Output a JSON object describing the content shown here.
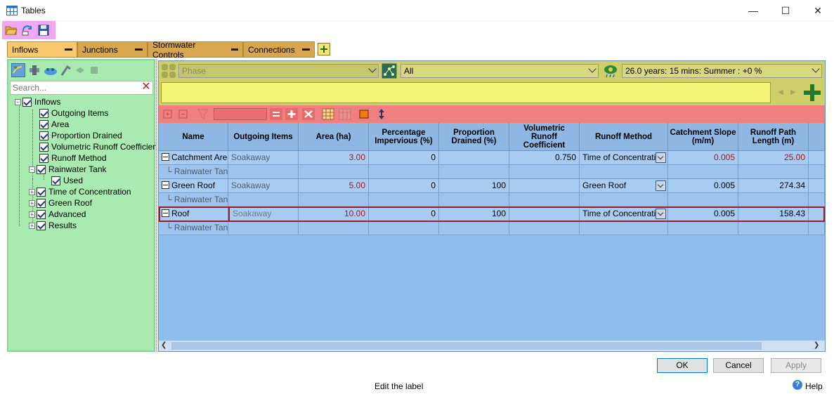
{
  "window": {
    "title": "Tables",
    "min": "—",
    "max": "☐",
    "close": "✕"
  },
  "toolbar": {
    "icons": [
      "open-folder-icon",
      "refresh-icon",
      "save-icon"
    ]
  },
  "tabs": [
    {
      "label": "Inflows",
      "active": true
    },
    {
      "label": "Junctions"
    },
    {
      "label": "Stormwater Controls"
    },
    {
      "label": "Connections"
    }
  ],
  "tree": {
    "search_placeholder": "Search...",
    "nodes": [
      {
        "label": "Inflows"
      },
      {
        "label": "Outgoing Items"
      },
      {
        "label": "Area"
      },
      {
        "label": "Proportion Drained"
      },
      {
        "label": "Volumetric Runoff Coefficient"
      },
      {
        "label": "Runoff Method"
      },
      {
        "label": "Rainwater Tank"
      },
      {
        "label": "Used"
      },
      {
        "label": "Time of Concentration"
      },
      {
        "label": "Green Roof"
      },
      {
        "label": "Advanced"
      },
      {
        "label": "Results"
      }
    ]
  },
  "filters": {
    "phase": "Phase",
    "scope": "All",
    "storm": "26.0 years: 15 mins: Summer : +0 %"
  },
  "grid": {
    "headers": [
      "Name",
      "Outgoing Items",
      "Area (ha)",
      "Percentage Impervious (%)",
      "Proportion Drained (%)",
      "Volumetric Runoff Coefficient",
      "Runoff Method",
      "Catchment Slope (m/m)",
      "Runoff Path Length (m)"
    ],
    "rows": [
      {
        "name": "Catchment Area",
        "outgoing": "Soakaway",
        "area": "3.00",
        "pct_impervious": "0",
        "prop_drained": "",
        "vrc": "0.750",
        "runoff_method": "Time of Concentration",
        "slope": "0.005",
        "path_length": "25.00",
        "sub": "└ Rainwater Tank"
      },
      {
        "name": "Green Roof",
        "outgoing": "Soakaway",
        "area": "5.00",
        "pct_impervious": "0",
        "prop_drained": "100",
        "vrc": "",
        "runoff_method": "Green Roof",
        "slope": "0.005",
        "path_length": "274.34",
        "sub": "└ Rainwater Tank"
      },
      {
        "name": "Roof",
        "outgoing": "Soakaway",
        "area": "10.00",
        "pct_impervious": "0",
        "prop_drained": "100",
        "vrc": "",
        "runoff_method": "Time of Concentration",
        "slope": "0.005",
        "path_length": "158.43",
        "sub": "└ Rainwater Tank"
      }
    ]
  },
  "footer": {
    "ok": "OK",
    "cancel": "Cancel",
    "apply": "Apply",
    "status": "Edit the label",
    "help": "Help"
  },
  "colors": {
    "toolbar": "#f0a8f2",
    "tab_active": "#f8c86a",
    "tree_bg": "#a8eab0",
    "filter_bg": "#cfcf6a",
    "edit_toolbar": "#f08080",
    "grid_bg": "#8fbeec"
  }
}
